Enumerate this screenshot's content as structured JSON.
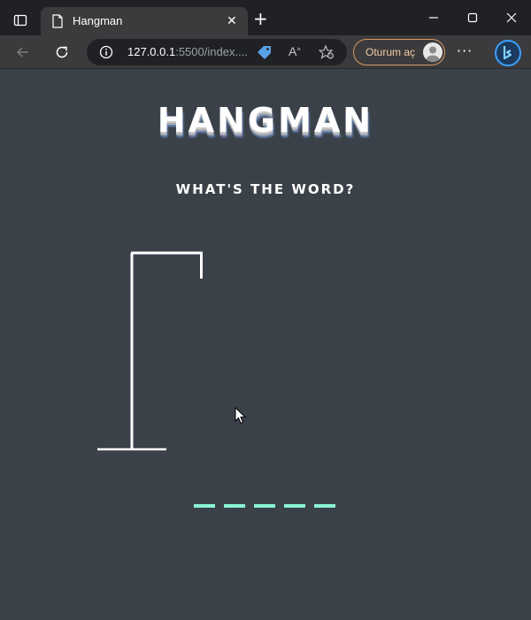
{
  "browser": {
    "tab_title": "Hangman",
    "url_host": "127.0.0.1",
    "url_rest": ":5500/index....",
    "signin_label": "Oturum aç",
    "read_aloud_label": "A",
    "more_label": "···",
    "close_tab_label": "✕",
    "new_tab_label": "+",
    "icons": [
      "sidebar-tabs-icon",
      "document-icon",
      "close-icon",
      "plus-icon",
      "minimize-icon",
      "maximize-icon",
      "window-close-icon",
      "back-arrow-icon",
      "reload-icon",
      "info-icon",
      "coupon-tag-icon",
      "read-aloud-icon",
      "favorite-icon",
      "avatar-icon",
      "more-icon",
      "bing-copilot-icon"
    ]
  },
  "page": {
    "title": "HANGMAN",
    "subtitle": "WHAT'S THE WORD?",
    "word_length": 5,
    "accent_color": "#8af5d4",
    "background_color": "#3b4149"
  }
}
